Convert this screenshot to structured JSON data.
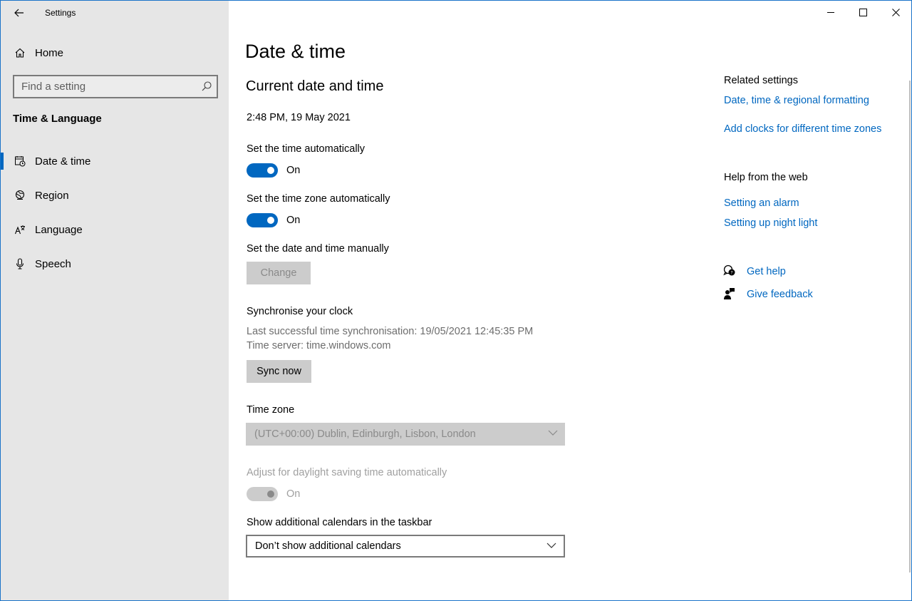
{
  "window": {
    "title": "Settings",
    "controls": {
      "minimize": "—",
      "maximize": "☐",
      "close": "✕"
    }
  },
  "sidebar": {
    "home_label": "Home",
    "search_placeholder": "Find a setting",
    "section_title": "Time & Language",
    "items": [
      {
        "label": "Date & time",
        "icon": "calendar-clock-icon",
        "active": true
      },
      {
        "label": "Region",
        "icon": "globe-icon",
        "active": false
      },
      {
        "label": "Language",
        "icon": "language-icon",
        "active": false
      },
      {
        "label": "Speech",
        "icon": "microphone-icon",
        "active": false
      }
    ]
  },
  "main": {
    "page_title": "Date & time",
    "section_title": "Current date and time",
    "current_datetime": "2:48 PM, 19 May 2021",
    "set_time_auto": {
      "label": "Set the time automatically",
      "state": "On"
    },
    "set_timezone_auto": {
      "label": "Set the time zone automatically",
      "state": "On"
    },
    "manual": {
      "label": "Set the date and time manually",
      "button": "Change"
    },
    "sync": {
      "title": "Synchronise your clock",
      "last_sync": "Last successful time synchronisation: 19/05/2021 12:45:35 PM",
      "server": "Time server: time.windows.com",
      "button": "Sync now"
    },
    "time_zone": {
      "label": "Time zone",
      "value": "(UTC+00:00) Dublin, Edinburgh, Lisbon, London"
    },
    "dst": {
      "label": "Adjust for daylight saving time automatically",
      "state": "On"
    },
    "calendars": {
      "label": "Show additional calendars in the taskbar",
      "value": "Don’t show additional calendars"
    }
  },
  "related": {
    "title": "Related settings",
    "links": [
      "Date, time & regional formatting",
      "Add clocks for different time zones"
    ],
    "help_title": "Help from the web",
    "help_links": [
      "Setting an alarm",
      "Setting up night light"
    ],
    "get_help": "Get help",
    "give_feedback": "Give feedback"
  },
  "colors": {
    "accent": "#0067c0",
    "sidebar_bg": "#e6e6e6",
    "window_border": "#1a73c9"
  }
}
